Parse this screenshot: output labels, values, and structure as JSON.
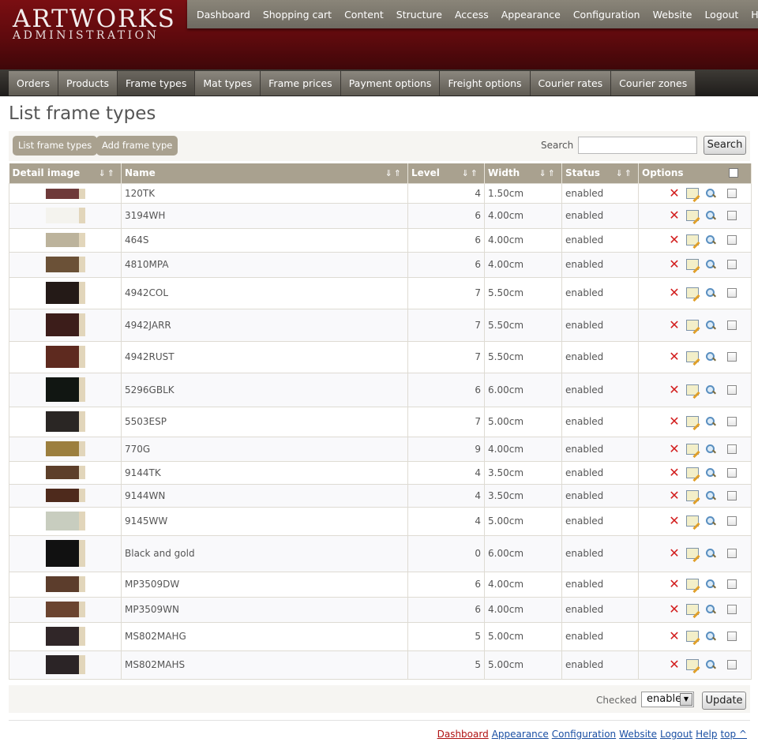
{
  "brand": {
    "title": "ARTWORKS",
    "subtitle": "ADMINISTRATION"
  },
  "topnav": [
    "Dashboard",
    "Shopping cart",
    "Content",
    "Structure",
    "Access",
    "Appearance",
    "Configuration",
    "Website",
    "Logout",
    "Help"
  ],
  "subnav": [
    "Orders",
    "Products",
    "Frame types",
    "Mat types",
    "Frame prices",
    "Payment options",
    "Freight options",
    "Courier rates",
    "Courier zones"
  ],
  "subnav_active": "Frame types",
  "page_title": "List frame types",
  "toolbar": {
    "list_btn": "List frame types",
    "add_btn": "Add frame type",
    "search_label": "Search",
    "search_value": "",
    "search_btn": "Search"
  },
  "table": {
    "headers": [
      "Detail image",
      "Name",
      "Level",
      "Width",
      "Status",
      "Options"
    ],
    "sort_glyph": "⇓⇑",
    "rows": [
      {
        "name": "120TK",
        "level": "4",
        "width": "1.50cm",
        "status": "enabled",
        "h": 25,
        "color": "#6e3a3a"
      },
      {
        "name": "3194WH",
        "level": "6",
        "width": "4.00cm",
        "status": "enabled",
        "h": 32,
        "color": "#f4f3ee"
      },
      {
        "name": "464S",
        "level": "6",
        "width": "4.00cm",
        "status": "enabled",
        "h": 30,
        "color": "#bcb39c"
      },
      {
        "name": "4810MPA",
        "level": "6",
        "width": "4.00cm",
        "status": "enabled",
        "h": 32,
        "color": "#6b5137"
      },
      {
        "name": "4942COL",
        "level": "7",
        "width": "5.50cm",
        "status": "enabled",
        "h": 40,
        "color": "#241a17"
      },
      {
        "name": "4942JARR",
        "level": "7",
        "width": "5.50cm",
        "status": "enabled",
        "h": 41,
        "color": "#3c1d1a"
      },
      {
        "name": "4942RUST",
        "level": "7",
        "width": "5.50cm",
        "status": "enabled",
        "h": 40,
        "color": "#5e2a1f"
      },
      {
        "name": "5296GBLK",
        "level": "6",
        "width": "6.00cm",
        "status": "enabled",
        "h": 43,
        "color": "#111612"
      },
      {
        "name": "5503ESP",
        "level": "7",
        "width": "5.00cm",
        "status": "enabled",
        "h": 38,
        "color": "#2a2624"
      },
      {
        "name": "770G",
        "level": "9",
        "width": "4.00cm",
        "status": "enabled",
        "h": 31,
        "color": "#9c7f3e"
      },
      {
        "name": "9144TK",
        "level": "4",
        "width": "3.50cm",
        "status": "enabled",
        "h": 29,
        "color": "#5d3f2a"
      },
      {
        "name": "9144WN",
        "level": "4",
        "width": "3.50cm",
        "status": "enabled",
        "h": 29,
        "color": "#4e2a1c"
      },
      {
        "name": "9145WW",
        "level": "4",
        "width": "5.00cm",
        "status": "enabled",
        "h": 36,
        "color": "#c8cdbf"
      },
      {
        "name": "Black and gold",
        "level": "0",
        "width": "6.00cm",
        "status": "enabled",
        "h": 46,
        "color": "#111111"
      },
      {
        "name": "MP3509DW",
        "level": "6",
        "width": "4.00cm",
        "status": "enabled",
        "h": 32,
        "color": "#5c3d2c"
      },
      {
        "name": "MP3509WN",
        "level": "6",
        "width": "4.00cm",
        "status": "enabled",
        "h": 32,
        "color": "#6b4430"
      },
      {
        "name": "MS802MAHG",
        "level": "5",
        "width": "5.00cm",
        "status": "enabled",
        "h": 36,
        "color": "#302628"
      },
      {
        "name": "MS802MAHS",
        "level": "5",
        "width": "5.00cm",
        "status": "enabled",
        "h": 36,
        "color": "#2b2426"
      }
    ]
  },
  "footer_bar": {
    "checked_label": "Checked",
    "select_value": "enable",
    "update_btn": "Update"
  },
  "footer_links": [
    "Dashboard",
    "Appearance",
    "Configuration",
    "Website",
    "Logout",
    "Help",
    "top ^"
  ]
}
